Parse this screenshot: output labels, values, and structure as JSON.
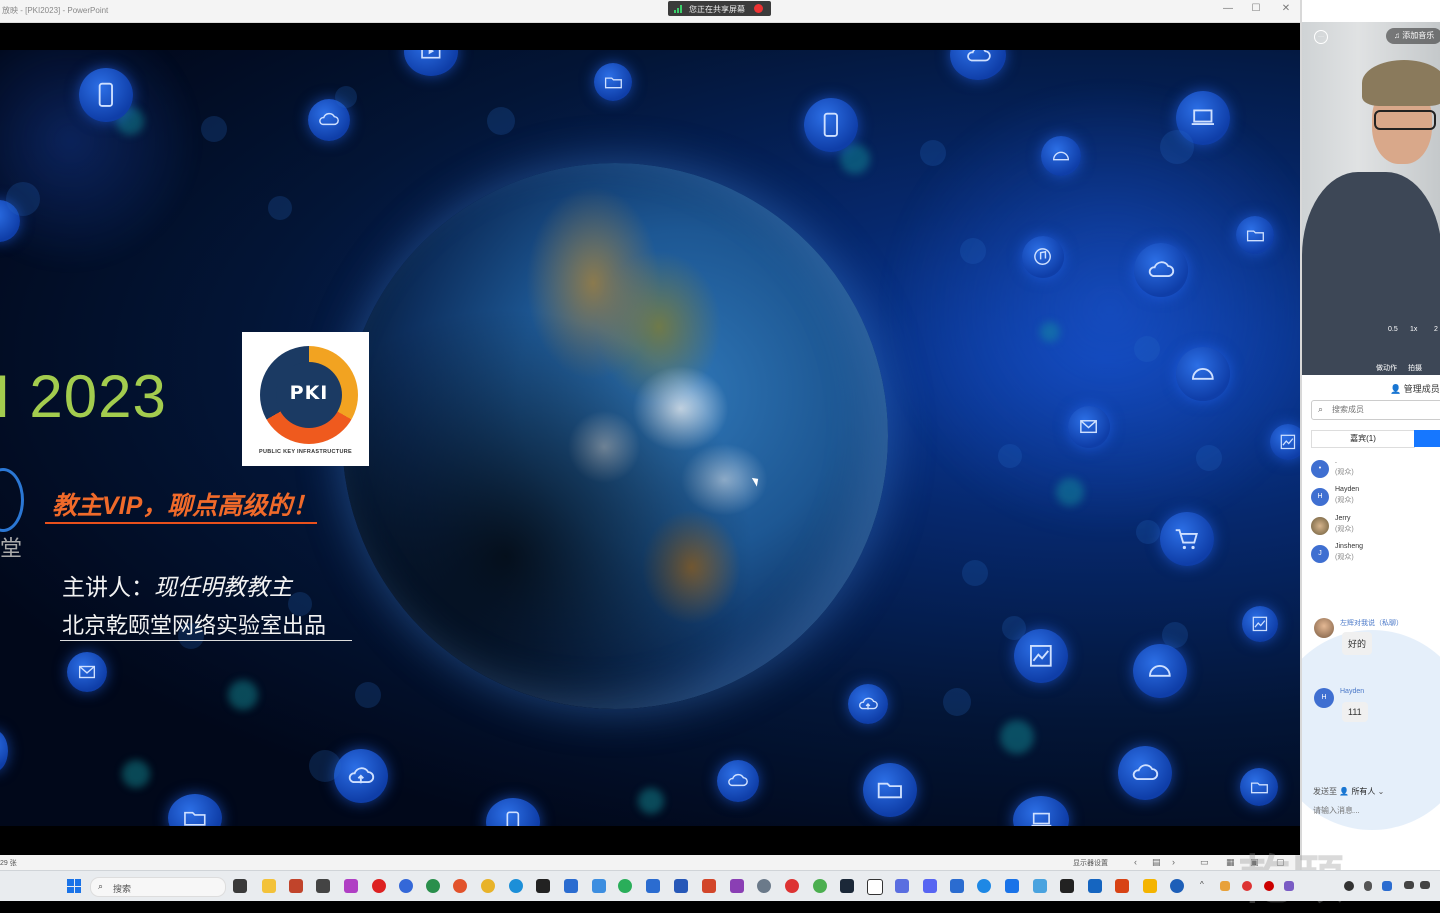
{
  "window": {
    "title": "放映 - [PKI2023] - PowerPoint",
    "min_glyph": "—",
    "max_glyph": "☐",
    "close_glyph": "✕"
  },
  "share_bar": {
    "label": "您正在共享屏幕"
  },
  "slide": {
    "heading": "I 2023",
    "logo_text": "PKI",
    "logo_caption": "PUBLIC KEY INFRASTRUCTURE",
    "left_logo_char": "堂",
    "slogan": "教主VIP，聊点高级的！",
    "speaker_label": "主讲人：",
    "speaker_name": "现任明教教主",
    "producer": "北京乾颐堂网络实验室出品",
    "background_color": "#031536",
    "accent_orange": "#f06a2a",
    "heading_green": "#a3cc4e"
  },
  "ppt_status": {
    "slide_count": "29 张",
    "display_settings": "显示器设置"
  },
  "panel": {
    "music_button": "添加音乐",
    "speed_05": "0.5",
    "speed_1x": "1x",
    "speed_2": "2",
    "action_label": "做动作",
    "capture_label": "拍摄",
    "manage_members": "管理成员",
    "search_placeholder": "搜索成员",
    "guests_tab": "嘉宾(1)",
    "members": [
      {
        "avatar": "•",
        "name": ".",
        "role": "(观众)"
      },
      {
        "avatar": "H",
        "name": "Hayden",
        "role": "(观众)"
      },
      {
        "avatar": "J",
        "name": "Jerry",
        "role": "(观众)"
      },
      {
        "avatar": "J",
        "name": "Jinsheng",
        "role": "(观众)"
      }
    ],
    "chat": [
      {
        "avatar": "",
        "name": "左辉对我说（私聊）",
        "text": "好的"
      },
      {
        "avatar": "H",
        "name": "Hayden",
        "text": "111"
      }
    ],
    "send_to_label": "发送至",
    "send_to_target": "所有人",
    "input_placeholder": "请输入消息..."
  },
  "taskbar": {
    "search_label": "搜索",
    "tray_label": "^",
    "watermark": "乾颐"
  },
  "icons": [
    "phone-icon",
    "cloud-icon",
    "folder-icon",
    "mail-icon",
    "gauge-icon",
    "laptop-icon",
    "music-icon",
    "cart-icon",
    "chart-icon",
    "upload-cloud-icon",
    "play-icon"
  ]
}
